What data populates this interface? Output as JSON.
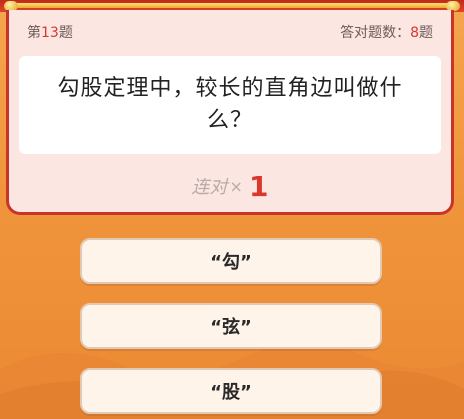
{
  "quiz": {
    "question_number_prefix": "第",
    "question_number": "13",
    "question_number_suffix": "题",
    "correct_label": "答对题数：",
    "correct_count": "8",
    "correct_suffix": "题",
    "question": "勾股定理中，较长的直角边叫做什么？",
    "streak_label": "连对",
    "streak_x": "×",
    "streak_count": "1",
    "options": [
      {
        "label": "“勾”"
      },
      {
        "label": "“弦”"
      },
      {
        "label": "“股”"
      }
    ]
  },
  "colors": {
    "accent_red": "#d8392c",
    "background_orange": "#f0953c",
    "card_background": "#fbe6e2"
  }
}
